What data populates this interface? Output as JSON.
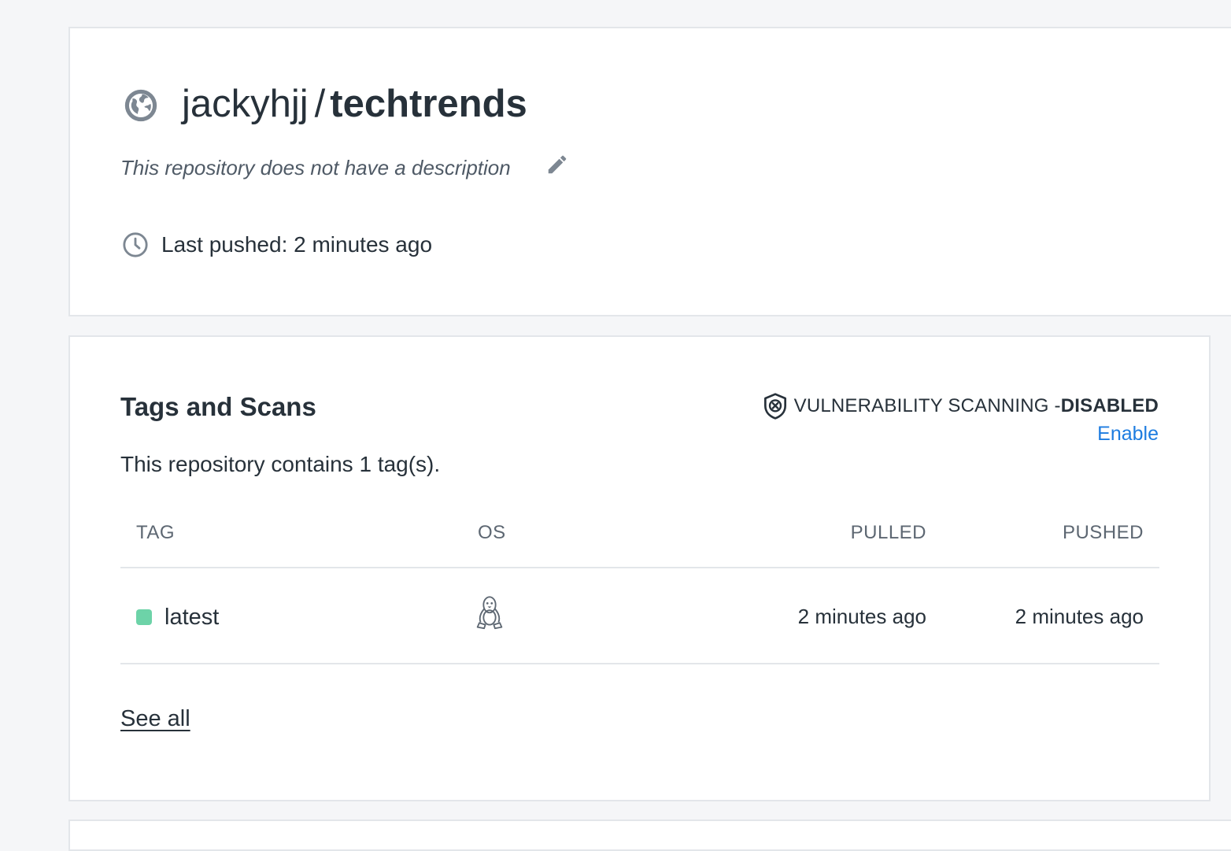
{
  "repository": {
    "namespace": "jackyhjj",
    "separator": "/",
    "name": "techtrends",
    "visibility_icon": "globe-icon",
    "description": "This repository does not have a description",
    "edit_icon": "pencil-icon",
    "last_pushed": "Last pushed: 2 minutes ago",
    "last_pushed_icon": "clock-icon"
  },
  "tags_section": {
    "title": "Tags and Scans",
    "tag_count_text": "This repository contains 1 tag(s).",
    "vulnerability": {
      "icon": "shield-x-icon",
      "label": "VULNERABILITY SCANNING - ",
      "status": "DISABLED",
      "enable_label": "Enable"
    },
    "columns": [
      "TAG",
      "OS",
      "PULLED",
      "PUSHED"
    ],
    "rows": [
      {
        "tag": "latest",
        "status_color": "#6dd3a8",
        "os_icon": "linux-icon",
        "pulled": "2 minutes ago",
        "pushed": "2 minutes ago"
      }
    ],
    "see_all_label": "See all"
  },
  "colors": {
    "background": "#f5f6f8",
    "card": "#ffffff",
    "border": "#e3e6ea",
    "text": "#27313a",
    "muted": "#5d6772",
    "link": "#1d7ce0",
    "tag_status": "#6dd3a8"
  }
}
